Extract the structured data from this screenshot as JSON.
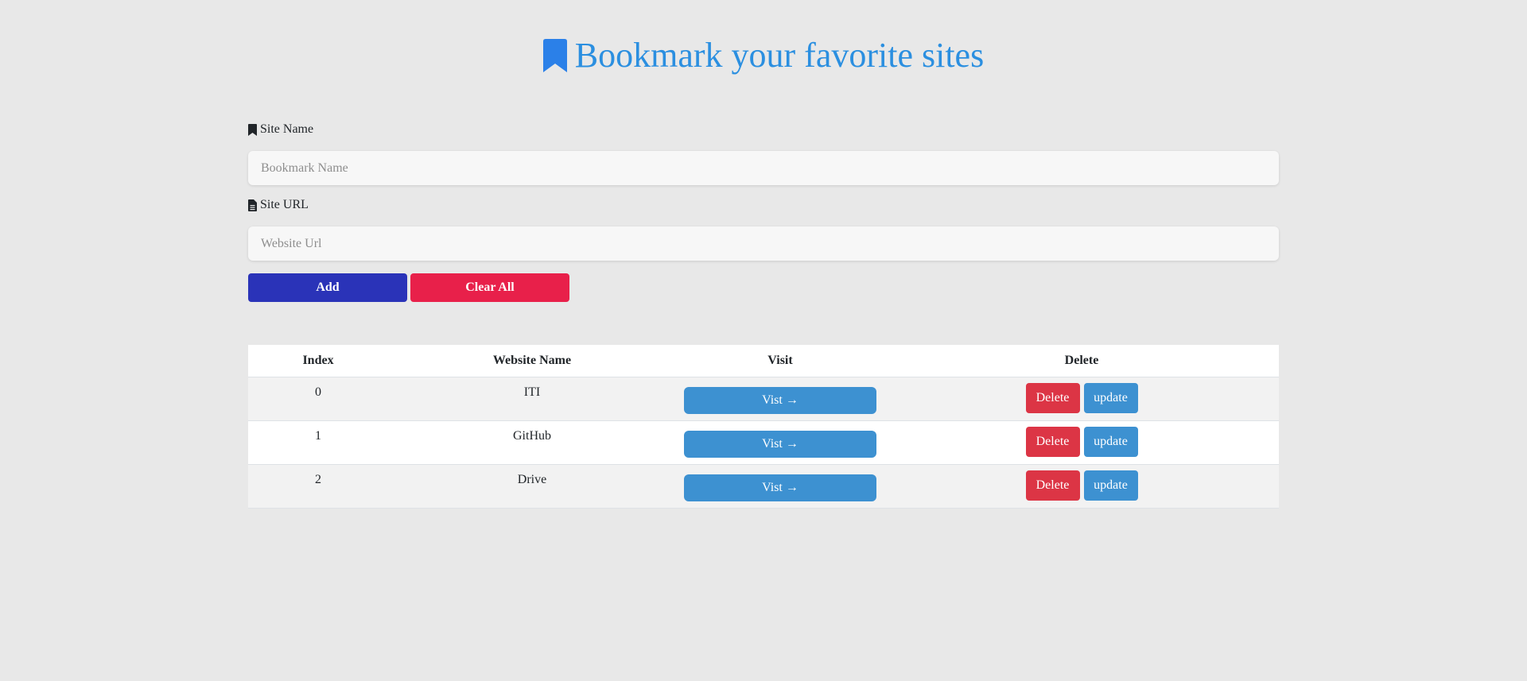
{
  "header": {
    "title": "Bookmark your favorite sites",
    "icon": "bookmark-icon",
    "title_color": "#2b8fe0"
  },
  "form": {
    "site_name_label": "Site Name",
    "site_name_icon": "bookmark-icon",
    "site_name_placeholder": "Bookmark Name",
    "site_url_label": "Site URL",
    "site_url_icon": "file-icon",
    "site_url_placeholder": "Website Url",
    "add_label": "Add",
    "clear_label": "Clear All",
    "add_color": "#2a33b8",
    "clear_color": "#e8204a"
  },
  "table": {
    "headers": [
      "Index",
      "Website Name",
      "Visit",
      "Delete"
    ],
    "rows": [
      {
        "index": "0",
        "name": "ITI",
        "visit": "Vist →",
        "delete": "Delete",
        "update": "update"
      },
      {
        "index": "1",
        "name": "GitHub",
        "visit": "Vist →",
        "delete": "Delete",
        "update": "update"
      },
      {
        "index": "2",
        "name": "Drive",
        "visit": "Vist →",
        "delete": "Delete",
        "update": "update"
      }
    ]
  },
  "colors": {
    "background": "#e8e8e8",
    "visit_button": "#3d91d1",
    "delete_button": "#dc3545",
    "update_button": "#3d91d1"
  }
}
